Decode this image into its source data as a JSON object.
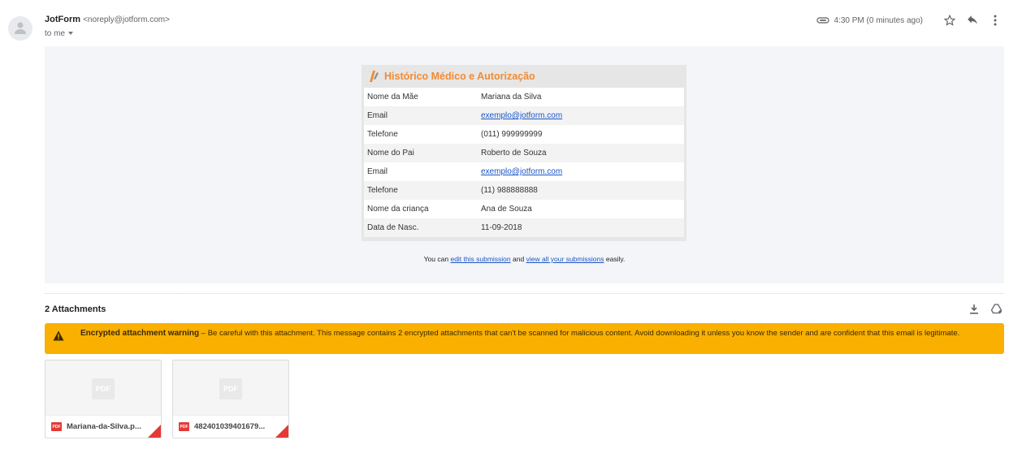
{
  "header": {
    "sender_name": "JotForm",
    "sender_email": "<noreply@jotform.com>",
    "recipient": "to me",
    "time": "4:30 PM (0 minutes ago)"
  },
  "form": {
    "title": "Histórico Médico e Autorização",
    "rows": [
      {
        "label": "Nome da Mãe",
        "value": "Mariana da Silva"
      },
      {
        "label": "Email",
        "value": "exemplo@jotform.com"
      },
      {
        "label": "Telefone",
        "value": "(011) 999999999"
      },
      {
        "label": "Nome do Pai",
        "value": "Roberto de Souza"
      },
      {
        "label": "Email",
        "value": "exemplo@jotform.com"
      },
      {
        "label": "Telefone",
        "value": "(11) 988888888"
      },
      {
        "label": "Nome da criança",
        "value": "Ana de Souza"
      },
      {
        "label": "Data de Nasc.",
        "value": "11-09-2018"
      }
    ]
  },
  "footnote": {
    "prefix": "You can",
    "edit_link": "edit this submission",
    "and": "and",
    "view_link": "view all your submissions",
    "suffix": "easily."
  },
  "attachments": {
    "title": "2 Attachments",
    "warning_title": "Encrypted attachment warning",
    "warning_text": " – Be careful with this attachment. This message contains 2 encrypted attachments that can't be scanned for malicious content. Avoid downloading it unless you know the sender and are confident that this email is legitimate.",
    "files": [
      {
        "name": "Mariana-da-Silva.p...",
        "badge": "PDF"
      },
      {
        "name": "482401039401679...",
        "badge": "PDF"
      }
    ]
  },
  "colors": {
    "accent_orange": "#f28b33",
    "warning_bg": "#f9b000",
    "link": "#1a55c4",
    "pdf_red": "#e53935"
  }
}
